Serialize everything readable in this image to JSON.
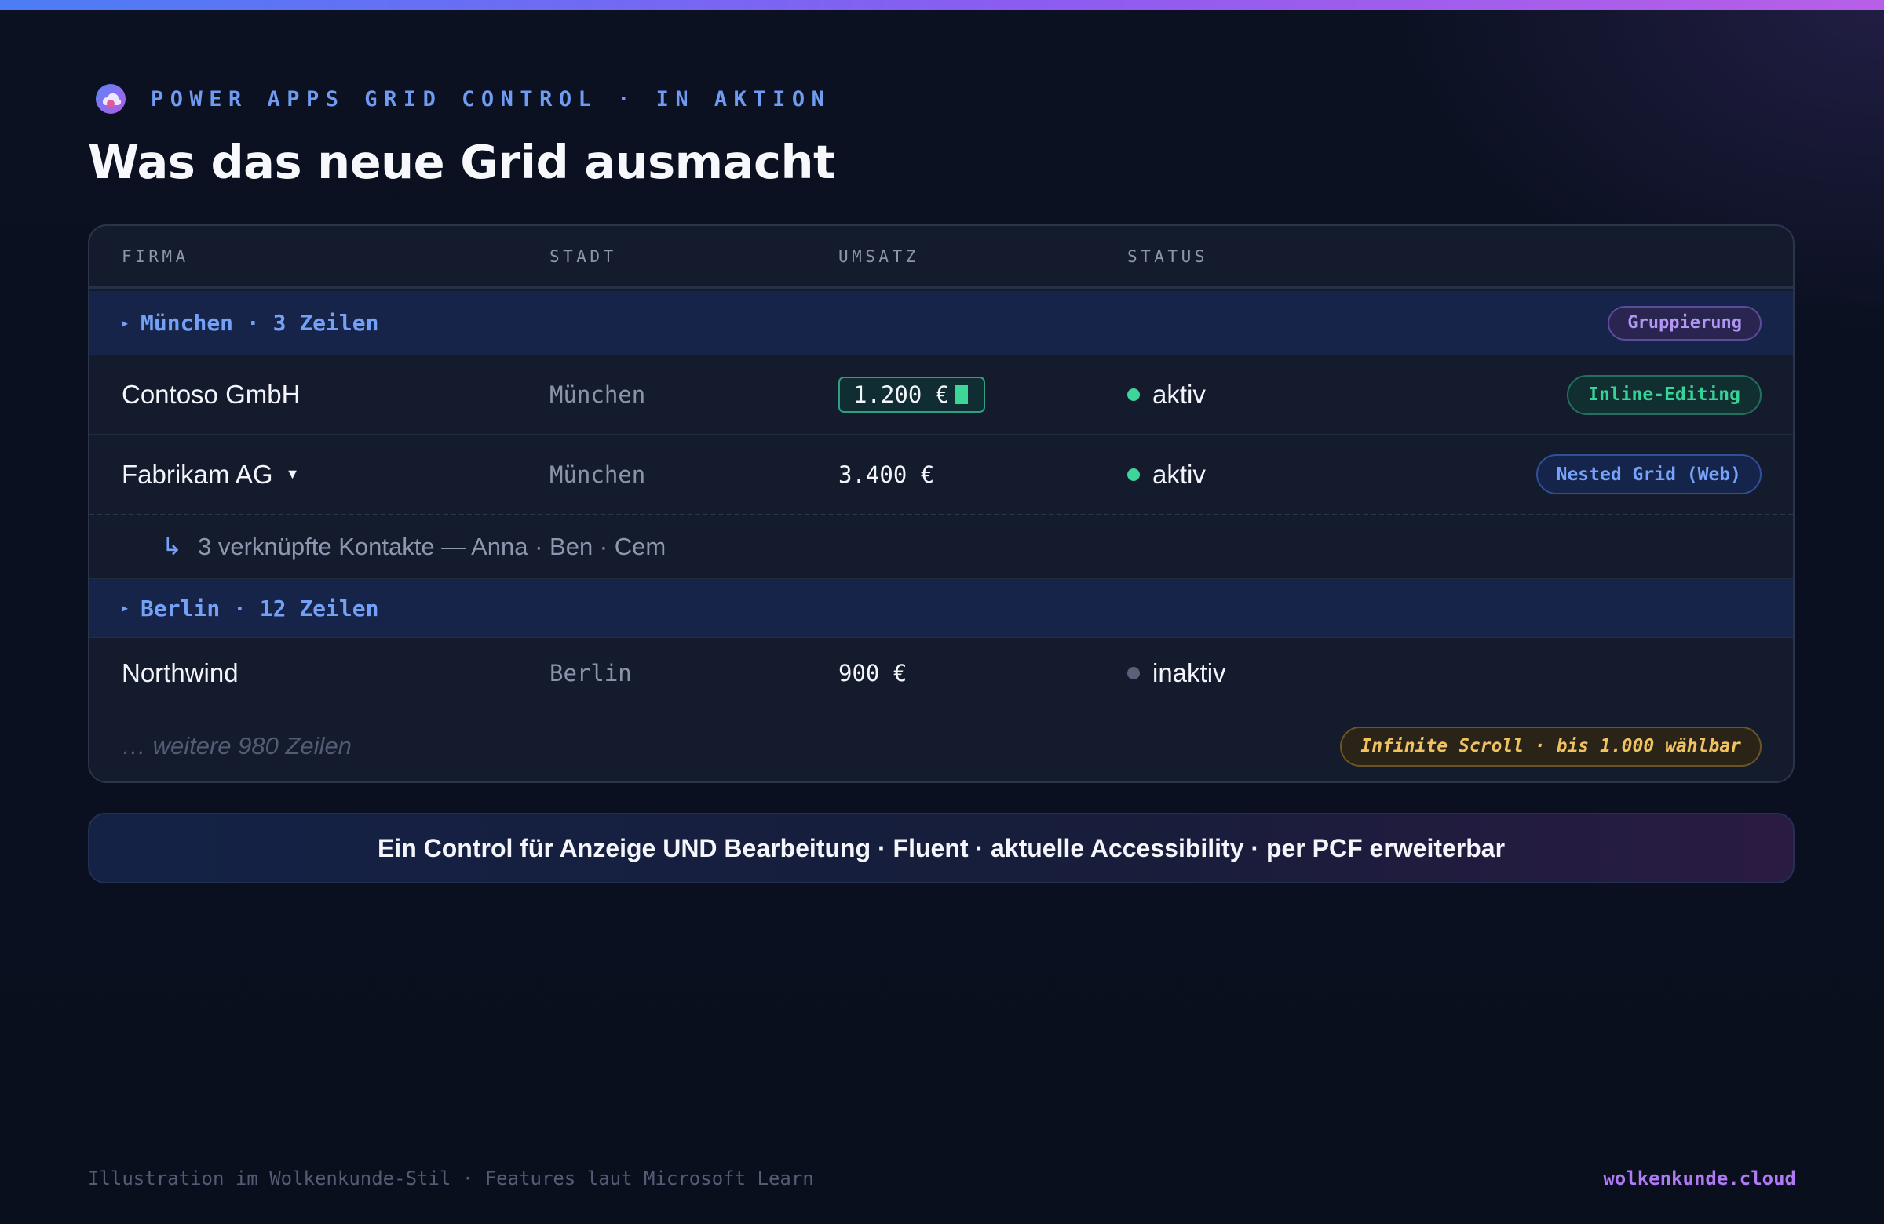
{
  "kicker": "POWER APPS GRID CONTROL · IN AKTION",
  "title": "Was das neue Grid ausmacht",
  "grid": {
    "columns": [
      "FIRMA",
      "STADT",
      "UMSATZ",
      "STATUS"
    ],
    "groups": [
      {
        "label": "München · 3 Zeilen",
        "badge": "Gruppierung",
        "rows": [
          {
            "firma": "Contoso GmbH",
            "stadt": "München",
            "umsatz": "1.200 €",
            "status": "aktiv",
            "badge": "Inline-Editing"
          },
          {
            "firma": "Fabrikam AG",
            "stadt": "München",
            "umsatz": "3.400 €",
            "status": "aktiv",
            "badge": "Nested Grid (Web)"
          }
        ],
        "nested": "3 verknüpfte Kontakte — Anna · Ben · Cem"
      },
      {
        "label": "Berlin · 12 Zeilen",
        "rows": [
          {
            "firma": "Northwind",
            "stadt": "Berlin",
            "umsatz": "900 €",
            "status": "inaktiv"
          }
        ]
      }
    ],
    "more": "… weitere 980 Zeilen",
    "more_badge": "Infinite Scroll · bis 1.000 wählbar"
  },
  "banner": "Ein Control für Anzeige UND Bearbeitung · Fluent · aktuelle Accessibility · per PCF erweiterbar",
  "footer": {
    "left": "Illustration im Wolkenkunde-Stil · Features laut Microsoft Learn",
    "right": "wolkenkunde.cloud"
  },
  "colors": {
    "accent_blue": "#74a0f6",
    "status_active": "#3dd598",
    "status_inactive": "#5b6178",
    "brand_purple": "#b07af5"
  },
  "icons": {
    "logo": "cloud-logo-icon",
    "group_toggle": "triangle-right-icon",
    "dropdown": "caret-down-icon",
    "nested": "return-arrow-icon"
  }
}
